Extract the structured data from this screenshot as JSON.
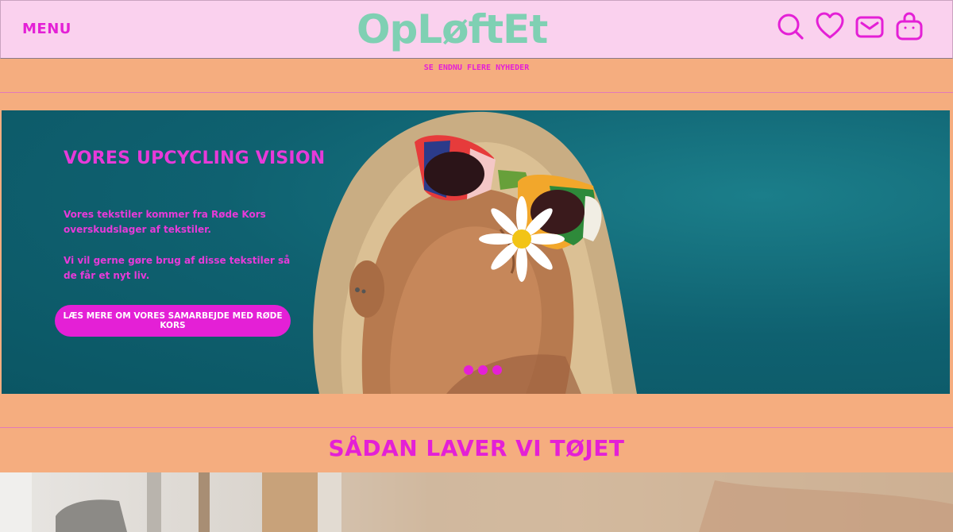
{
  "header": {
    "menu_label": "MENU",
    "logo_text": "OpLøftEt",
    "icons": [
      "search-icon",
      "heart-icon",
      "mail-icon",
      "shopping-bag-icon"
    ]
  },
  "news": {
    "link_label": "SE ENDNU FLERE NYHEDER"
  },
  "hero": {
    "title": "VORES UPCYCLING VISION",
    "paragraph1": "Vores tekstiler kommer fra Røde Kors overskudslager af tekstiler.",
    "paragraph2": "Vi vil gerne gøre brug af disse tekstiler så de får et nyt liv.",
    "cta_label": "LÆS MERE OM VORES SAMARBEJDE MED RØDE KORS",
    "slide_count": 3
  },
  "section": {
    "title": "SÅDAN LAVER VI TØJET"
  },
  "colors": {
    "accent": "#e420d6",
    "header_bg": "#fad1ee",
    "page_bg": "#f5ad7f",
    "hero_bg": "#0f6170",
    "logo": "#7fd0b3"
  }
}
